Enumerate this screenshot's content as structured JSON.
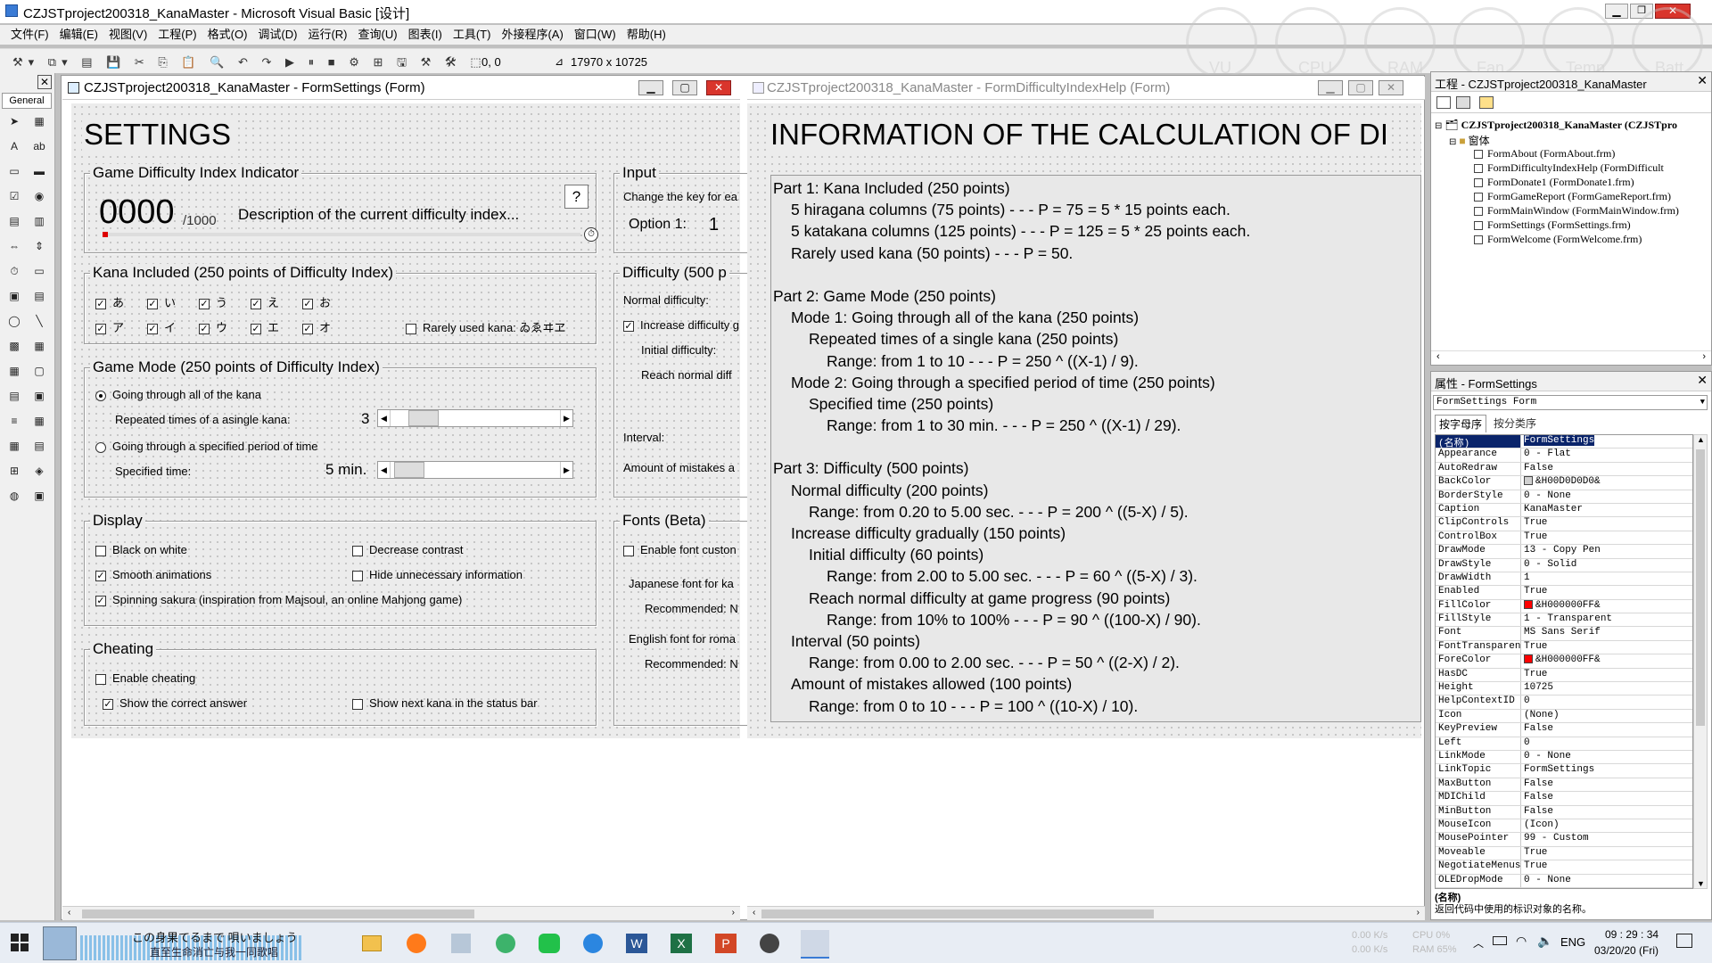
{
  "ide": {
    "title": "CZJSTproject200318_KanaMaster - Microsoft Visual Basic [设计]",
    "menu": [
      "文件(F)",
      "编辑(E)",
      "视图(V)",
      "工程(P)",
      "格式(O)",
      "调试(D)",
      "运行(R)",
      "查询(U)",
      "图表(I)",
      "工具(T)",
      "外接程序(A)",
      "窗口(W)",
      "帮助(H)"
    ],
    "toolbar": {
      "position": "0, 0",
      "size": "17970 x 10725"
    },
    "gauges": [
      "VU",
      "CPU",
      "RAM",
      "Fan",
      "Temp",
      "Batt"
    ],
    "toolbox_label": "General",
    "form_settings": {
      "title": "CZJSTproject200318_KanaMaster - FormSettings (Form)",
      "heading": "SETTINGS",
      "indicator": {
        "legend": "Game Difficulty Index Indicator",
        "value": "0000",
        "max": "/1000",
        "description": "Description of the current difficulty index...",
        "help": "?"
      },
      "input": {
        "legend": "Input",
        "hint": "Change the key for ea",
        "option_label": "Option 1:",
        "option_value": "1"
      },
      "kana": {
        "legend": "Kana Included  (250 points of Difficulty Index)",
        "hiragana": [
          "あ",
          "い",
          "う",
          "え",
          "お"
        ],
        "katakana": [
          "ア",
          "イ",
          "ウ",
          "エ",
          "オ"
        ],
        "rare_label": "Rarely used kana: ゐゑヰヱ"
      },
      "difficulty": {
        "legend": "Difficulty  (500 p",
        "normal": "Normal difficulty:",
        "increase": "Increase difficulty g",
        "initial": "Initial difficulty:",
        "reach": "Reach normal diff",
        "interval": "Interval:",
        "mistakes": "Amount of mistakes a"
      },
      "game_mode": {
        "legend": "Game Mode  (250 points of Difficulty Index)",
        "opt1": "Going through all of the kana",
        "repeat_label": "Repeated times of a asingle kana:",
        "repeat_value": "3",
        "opt2": "Going through a specified period of time",
        "time_label": "Specified time:",
        "time_value": "5 min."
      },
      "display": {
        "legend": "Display",
        "black_on_white": "Black on white",
        "decrease_contrast": "Decrease contrast",
        "smooth": "Smooth animations",
        "hide_info": "Hide unnecessary information",
        "sakura": "Spinning sakura  (inspiration from Majsoul, an online Mahjong game)"
      },
      "fonts": {
        "legend": "Fonts  (Beta)",
        "enable_custom": "Enable font custon",
        "japanese": "Japanese font for ka",
        "recommended1": "Recommended: N",
        "english": "English font for roma",
        "recommended2": "Recommended: N"
      },
      "cheating": {
        "legend": "Cheating",
        "enable": "Enable cheating",
        "show_answer": "Show the correct answer",
        "show_next": "Show next kana in the status bar"
      }
    },
    "form_help": {
      "title": "CZJSTproject200318_KanaMaster - FormDifficultyIndexHelp (Form)",
      "heading": "INFORMATION  OF  THE  CALCULATION  OF  DI",
      "lines": [
        {
          "indent": 0,
          "text": "Part 1: Kana Included (250 points)"
        },
        {
          "indent": 1,
          "text": "5 hiragana columns (75 points) - - - P = 75 = 5 * 15 points each."
        },
        {
          "indent": 1,
          "text": "5 katakana columns (125 points) - - - P = 125 = 5 * 25 points each."
        },
        {
          "indent": 1,
          "text": "Rarely used kana (50 points) - - - P = 50."
        },
        {
          "indent": 0,
          "text": ""
        },
        {
          "indent": 0,
          "text": "Part 2: Game Mode (250 points)"
        },
        {
          "indent": 1,
          "text": "Mode 1: Going through all of the kana (250 points)"
        },
        {
          "indent": 2,
          "text": "Repeated times of a single kana (250 points)"
        },
        {
          "indent": 3,
          "text": "Range: from 1 to 10 - - - P = 250 ^ ((X-1) / 9)."
        },
        {
          "indent": 1,
          "text": "Mode 2: Going through a specified period of time (250 points)"
        },
        {
          "indent": 2,
          "text": "Specified time (250 points)"
        },
        {
          "indent": 3,
          "text": "Range: from 1 to 30 min. - - - P = 250 ^ ((X-1) / 29)."
        },
        {
          "indent": 0,
          "text": ""
        },
        {
          "indent": 0,
          "text": "Part 3: Difficulty (500 points)"
        },
        {
          "indent": 1,
          "text": "Normal difficulty (200 points)"
        },
        {
          "indent": 2,
          "text": "Range: from 0.20 to 5.00 sec. - - - P = 200 ^ ((5-X) / 5)."
        },
        {
          "indent": 1,
          "text": "Increase difficulty gradually (150 points)"
        },
        {
          "indent": 2,
          "text": "Initial difficulty (60 points)"
        },
        {
          "indent": 3,
          "text": "Range: from 2.00 to 5.00 sec. - - - P = 60 ^ ((5-X) / 3)."
        },
        {
          "indent": 2,
          "text": "Reach normal difficulty at game progress (90 points)"
        },
        {
          "indent": 3,
          "text": "Range: from 10% to 100% - - - P = 90 ^ ((100-X) / 90)."
        },
        {
          "indent": 1,
          "text": "Interval (50 points)"
        },
        {
          "indent": 2,
          "text": "Range: from 0.00 to 2.00 sec. - - - P = 50 ^ ((2-X) / 2)."
        },
        {
          "indent": 1,
          "text": "Amount of mistakes allowed (100 points)"
        },
        {
          "indent": 2,
          "text": "Range: from 0 to 10 - - - P = 100 ^ ((10-X) / 10)."
        }
      ]
    },
    "project": {
      "title": "工程 - CZJSTproject200318_KanaMaster",
      "root": "CZJSTproject200318_KanaMaster (CZJSTpro",
      "folder": "窗体",
      "items": [
        "FormAbout (FormAbout.frm)",
        "FormDifficultyIndexHelp (FormDifficult",
        "FormDonate1 (FormDonate1.frm)",
        "FormGameReport (FormGameReport.frm)",
        "FormMainWindow (FormMainWindow.frm)",
        "FormSettings (FormSettings.frm)",
        "FormWelcome (FormWelcome.frm)"
      ]
    },
    "properties": {
      "title": "属性 - FormSettings",
      "object": "FormSettings  Form",
      "tab_alpha": "按字母序",
      "tab_cat": "按分类序",
      "rows": [
        {
          "k": "(名称)",
          "v": "FormSettings"
        },
        {
          "k": "Appearance",
          "v": "0 - Flat"
        },
        {
          "k": "AutoRedraw",
          "v": "False"
        },
        {
          "k": "BackColor",
          "v": "&H00D0D0D0&"
        },
        {
          "k": "BorderStyle",
          "v": "0 - None"
        },
        {
          "k": "Caption",
          "v": "KanaMaster"
        },
        {
          "k": "ClipControls",
          "v": "True"
        },
        {
          "k": "ControlBox",
          "v": "True"
        },
        {
          "k": "DrawMode",
          "v": "13 - Copy Pen"
        },
        {
          "k": "DrawStyle",
          "v": "0 - Solid"
        },
        {
          "k": "DrawWidth",
          "v": "1"
        },
        {
          "k": "Enabled",
          "v": "True"
        },
        {
          "k": "FillColor",
          "v": "&H000000FF&"
        },
        {
          "k": "FillStyle",
          "v": "1 - Transparent"
        },
        {
          "k": "Font",
          "v": "MS Sans Serif"
        },
        {
          "k": "FontTransparent",
          "v": "True"
        },
        {
          "k": "ForeColor",
          "v": "&H000000FF&"
        },
        {
          "k": "HasDC",
          "v": "True"
        },
        {
          "k": "Height",
          "v": "10725"
        },
        {
          "k": "HelpContextID",
          "v": "0"
        },
        {
          "k": "Icon",
          "v": "(None)"
        },
        {
          "k": "KeyPreview",
          "v": "False"
        },
        {
          "k": "Left",
          "v": "0"
        },
        {
          "k": "LinkMode",
          "v": "0 - None"
        },
        {
          "k": "LinkTopic",
          "v": "FormSettings"
        },
        {
          "k": "MaxButton",
          "v": "False"
        },
        {
          "k": "MDIChild",
          "v": "False"
        },
        {
          "k": "MinButton",
          "v": "False"
        },
        {
          "k": "MouseIcon",
          "v": "(Icon)"
        },
        {
          "k": "MousePointer",
          "v": "99 - Custom"
        },
        {
          "k": "Moveable",
          "v": "True"
        },
        {
          "k": "NegotiateMenus",
          "v": "True"
        },
        {
          "k": "OLEDropMode",
          "v": "0 - None"
        }
      ],
      "desc_title": "(名称)",
      "desc_text": "返回代码中使用的标识对象的名称。",
      "colors": {
        "backcolor": "#d0d0d0",
        "red": "#ff0000"
      }
    }
  },
  "taskbar": {
    "music_line1": "この身果てるまで 唄いましょう",
    "music_line2": "直至生命消亡与我一同歌唱",
    "net_up": "0.00 K/s",
    "net_down": "0.00 K/s",
    "cpu": "CPU  0%",
    "ram": "RAM  65%",
    "lang": "ENG",
    "time": "09 : 29 : 34",
    "date": "03/20/20 (Fri)"
  }
}
